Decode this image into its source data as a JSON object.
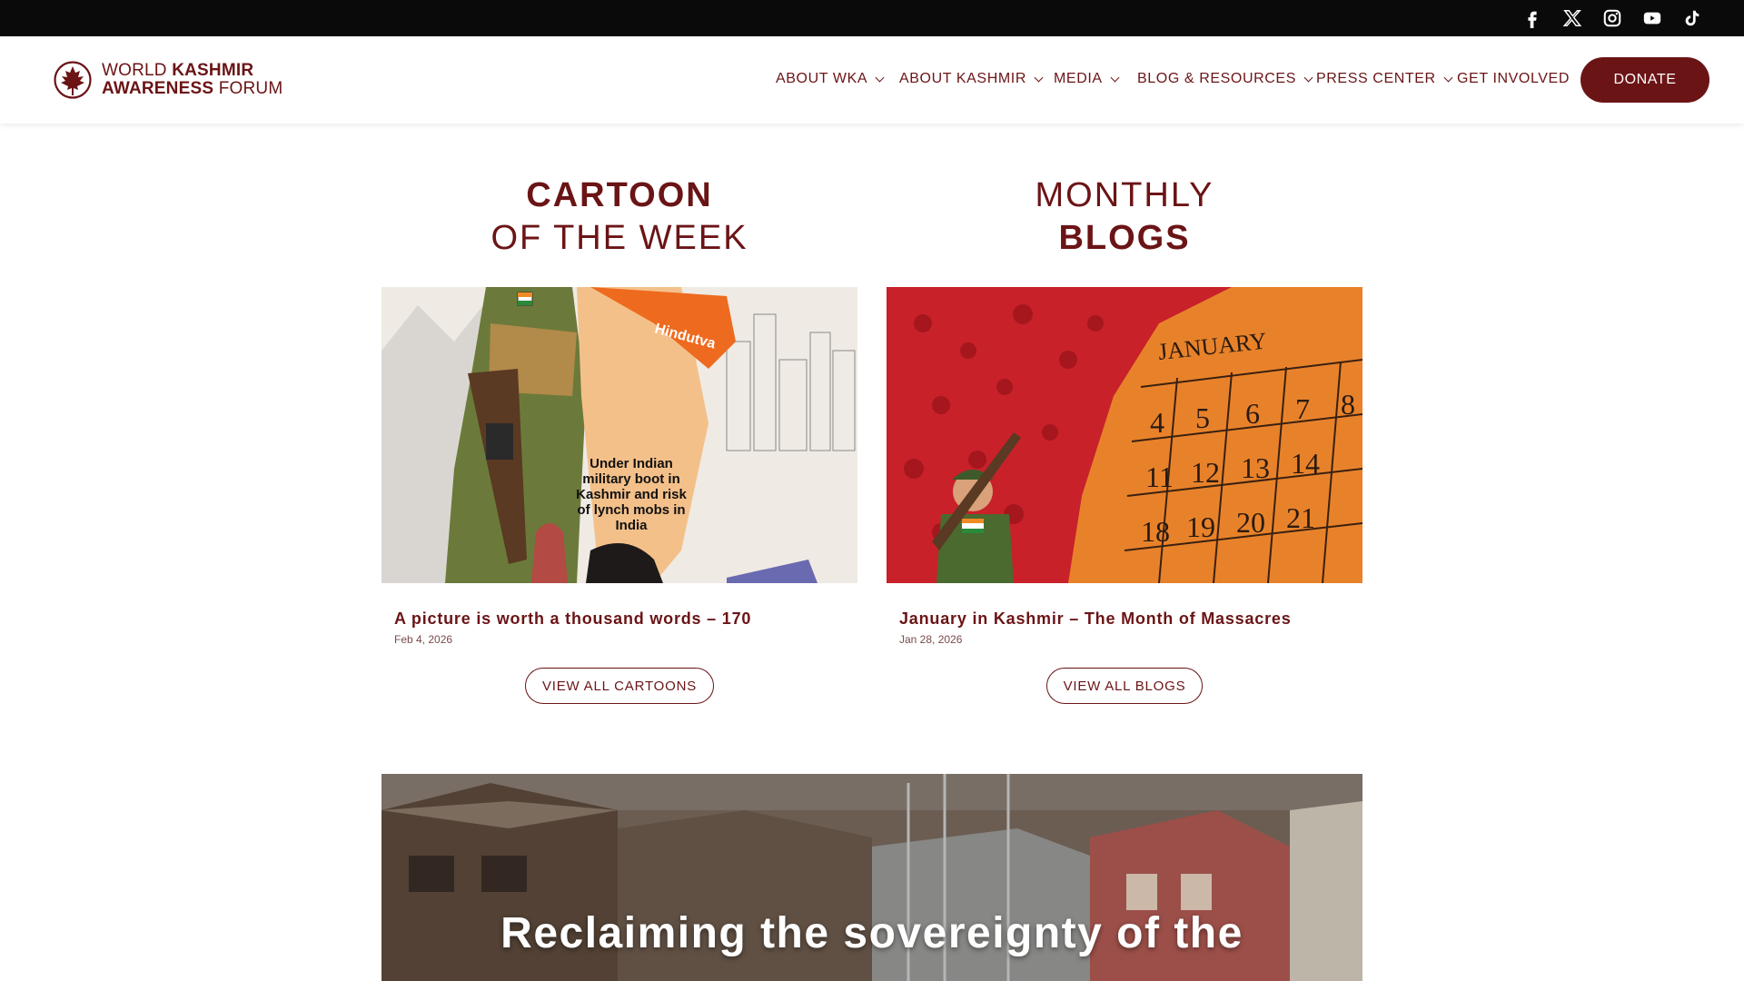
{
  "social": {
    "icons": [
      "facebook-icon",
      "x-icon",
      "instagram-icon",
      "youtube-icon",
      "tiktok-icon"
    ]
  },
  "header": {
    "logo_line1_light": "WORLD ",
    "logo_line1_bold": "KASHMIR",
    "logo_line2_bold": "AWARENESS ",
    "logo_line2_light": "FORUM",
    "nav": [
      {
        "label": "ABOUT WKA"
      },
      {
        "label": "ABOUT KASHMIR"
      },
      {
        "label": "MEDIA"
      },
      {
        "label": "BLOG & RESOURCES"
      },
      {
        "label": "PRESS CENTER"
      },
      {
        "label": "GET INVOLVED"
      }
    ],
    "donate_label": "DONATE"
  },
  "cartoon": {
    "heading_bold": "CARTOON",
    "heading_light": "OF THE WEEK",
    "image_caption": "Under Indian military boot in Kashmir and risk of lynch mobs in India",
    "image_tag": "Hindutva",
    "title": "A picture is worth a thousand words – 170",
    "date": "Feb 4, 2026",
    "button_label": "VIEW ALL CARTOONS"
  },
  "blogs": {
    "heading_light": "MONTHLY",
    "heading_bold": "BLOGS",
    "calendar_month": "JANUARY",
    "title": "January in Kashmir – The Month of Massacres",
    "date": "Jan 28, 2026",
    "button_label": "VIEW ALL BLOGS"
  },
  "banner": {
    "text": "Reclaiming the sovereignty of the"
  },
  "colors": {
    "brand": "#6b1416",
    "topbar": "#0a0a0a",
    "blog_red": "#c8212a",
    "blog_orange": "#e8822a"
  }
}
